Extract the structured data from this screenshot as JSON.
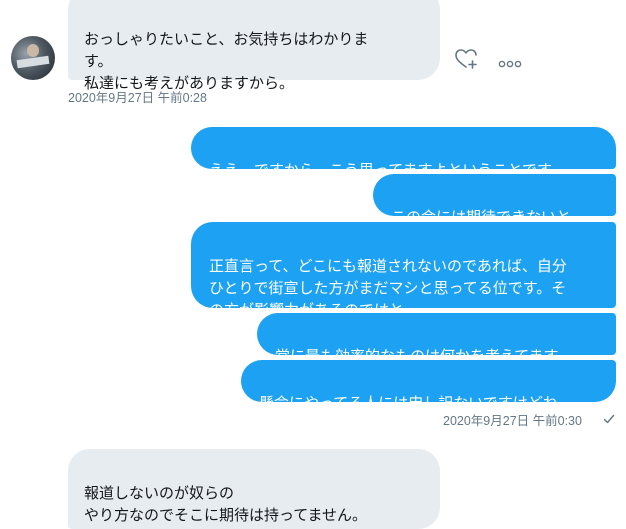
{
  "thread": {
    "messages": [
      {
        "text": "おっしゃりたいこと、お気持ちはわかりま\nす。\n私達にも考えがありますから。"
      },
      {
        "text": "ええ、ですから、こう思ってますよということです。"
      },
      {
        "text": "この会には期待できないと。"
      },
      {
        "text": "正直言って、どこにも報道されないのであれば、自分\nひとりで街宣した方がまだマシと思ってる位です。そ\nの方が影響力があるのではと。"
      },
      {
        "text": "常に最も効率的なものは何かを考えてます。"
      },
      {
        "text": "懸命にやってる人には申し訳ないですけどね。"
      },
      {
        "text": "報道しないのが奴らの\nやり方なのでそこに期待は持ってません。"
      }
    ],
    "timestamps": {
      "received_1": "2020年9月27日 午前0:28",
      "sent_1": "2020年9月27日 午前0:30"
    }
  },
  "icons": {
    "like": "heart-plus-icon",
    "more": "more-horizontal-icon",
    "read": "check-icon"
  },
  "colors": {
    "sent_bubble": "#1da1f2",
    "received_bubble": "#e6ecf0",
    "meta_text": "#657786"
  }
}
